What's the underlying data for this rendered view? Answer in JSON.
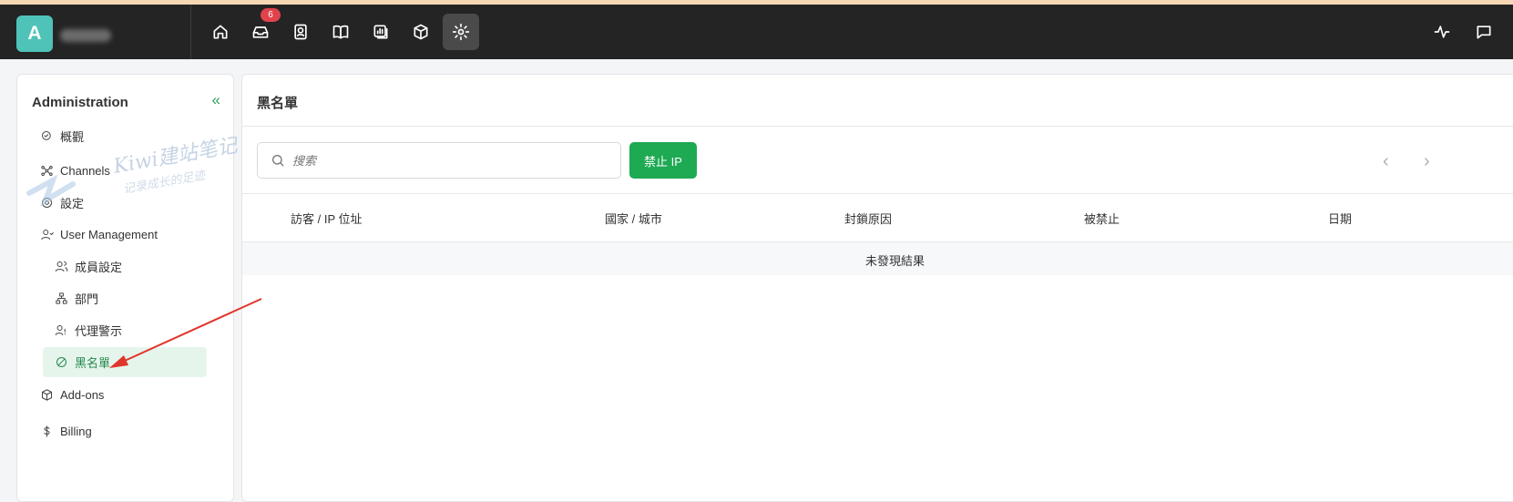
{
  "topbar": {
    "avatar_letter": "A",
    "badge_count": "6",
    "nav_icons": [
      "home-icon",
      "inbox-icon",
      "contacts-icon",
      "book-icon",
      "reports-icon",
      "box-icon",
      "gear-icon"
    ],
    "right_icons": [
      "activity-icon",
      "chat-icon"
    ]
  },
  "sidebar": {
    "title": "Administration",
    "collapse": "«",
    "items": [
      {
        "label": "概觀",
        "icon": "overview-icon"
      },
      {
        "label": "Channels",
        "icon": "channels-icon"
      },
      {
        "label": "設定",
        "icon": "gear-icon"
      },
      {
        "label": "User Management",
        "icon": "user-icon"
      },
      {
        "label": "成員設定",
        "icon": "members-icon"
      },
      {
        "label": "部門",
        "icon": "departments-icon"
      },
      {
        "label": "代理警示",
        "icon": "agent-alert-icon"
      },
      {
        "label": "黑名單",
        "icon": "ban-icon"
      },
      {
        "label": "Add-ons",
        "icon": "box-icon"
      },
      {
        "label": "Billing",
        "icon": "dollar-icon"
      }
    ]
  },
  "main": {
    "title": "黑名單",
    "search_placeholder": "搜索",
    "ban_button": "禁止 IP",
    "pager_prev": "‹",
    "pager_next": "›",
    "columns": [
      "訪客 / IP 位址",
      "國家 / 城市",
      "封鎖原因",
      "被禁止",
      "日期"
    ],
    "empty_text": "未發現結果"
  },
  "watermark": {
    "line1": "Kiwi建站笔记",
    "line2": "记录成长的足迹"
  },
  "colors": {
    "topbar": "#242424",
    "accent_green": "#1ea953",
    "active_bg": "#e6f5ec",
    "badge_red": "#e0434c",
    "arrow_red": "#e0352b"
  }
}
